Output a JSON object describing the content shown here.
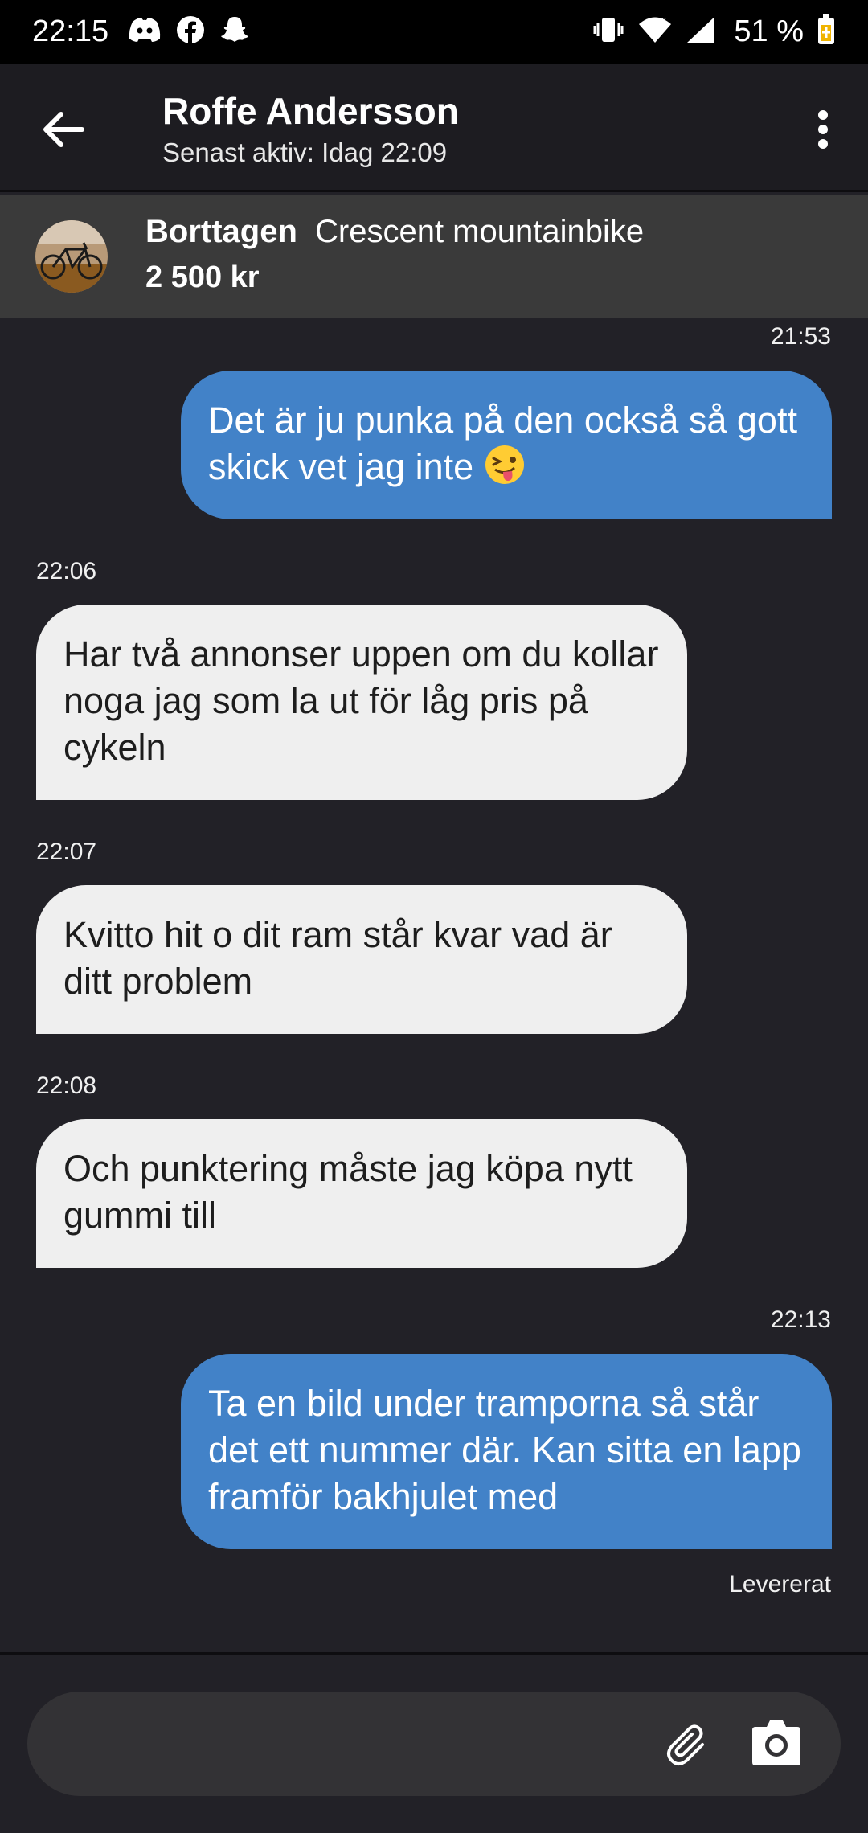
{
  "status_bar": {
    "time": "22:15",
    "battery_percent": "51 %",
    "left_icons": [
      "discord-icon",
      "facebook-icon",
      "snapchat-icon"
    ],
    "right_icons": [
      "vibrate-icon",
      "wifi-icon",
      "signal-icon",
      "battery-icon"
    ]
  },
  "header": {
    "title": "Roffe Andersson",
    "subtitle": "Senast aktiv: Idag 22:09"
  },
  "listing": {
    "status": "Borttagen",
    "title": "Crescent mountainbike",
    "price": "2 500 kr"
  },
  "messages": [
    {
      "direction": "outgoing",
      "timestamp": "21:53",
      "text": "Det är ju punka på den också så gott skick vet jag inte",
      "emoji": "winking-face-with-tongue"
    },
    {
      "direction": "incoming",
      "timestamp": "22:06",
      "text": "Har två annonser uppen om du kollar noga jag som la ut för låg pris på cykeln"
    },
    {
      "direction": "incoming",
      "timestamp": "22:07",
      "text": "Kvitto hit o dit ram står kvar vad är ditt problem"
    },
    {
      "direction": "incoming",
      "timestamp": "22:08",
      "text": "Och punktering måste jag köpa nytt gummi till"
    },
    {
      "direction": "outgoing",
      "timestamp": "22:13",
      "text": "Ta en bild under tramporna så står det ett nummer där. Kan sitta en lapp framför bakhjulet med"
    }
  ],
  "delivery_status": "Levererat",
  "composer": {
    "placeholder": "",
    "icons": [
      "paperclip-icon",
      "camera-icon"
    ]
  },
  "colors": {
    "background": "#222127",
    "outgoing_bubble": "#4282c8",
    "incoming_bubble": "#efefef",
    "listing_banner": "#3a3a3a"
  }
}
